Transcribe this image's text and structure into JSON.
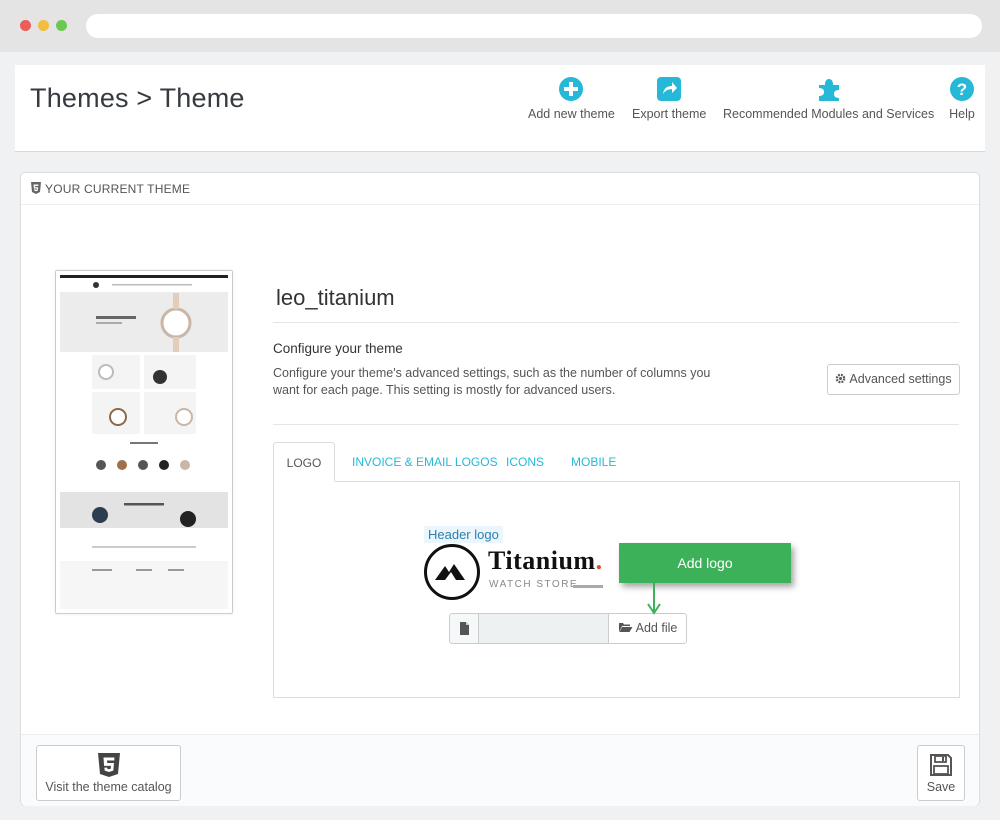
{
  "header": {
    "title": "Themes > Theme",
    "toolbar": [
      {
        "label": "Add new theme",
        "icon": "plus-circle-icon"
      },
      {
        "label": "Export theme",
        "icon": "export-icon"
      },
      {
        "label": "Recommended Modules and Services",
        "icon": "puzzle-icon"
      },
      {
        "label": "Help",
        "icon": "help-icon"
      }
    ]
  },
  "panel": {
    "heading": "YOUR CURRENT THEME",
    "theme_name": "leo_titanium",
    "configure_title": "Configure your theme",
    "configure_desc": "Configure your theme's advanced settings, such as the number of columns you want for each page. This setting is mostly for advanced users.",
    "advanced_settings_label": "Advanced settings"
  },
  "tabs": [
    {
      "label": "LOGO",
      "active": true
    },
    {
      "label": "INVOICE & EMAIL LOGOS",
      "active": false
    },
    {
      "label": "ICONS",
      "active": false
    },
    {
      "label": "MOBILE",
      "active": false
    }
  ],
  "logo_tab": {
    "header_logo_label": "Header logo",
    "logo_word": "Titanium",
    "logo_dot": ".",
    "logo_sub": "WATCH STORE",
    "file_value": "",
    "add_file_label": "Add file",
    "callout": "Add logo"
  },
  "footer": {
    "catalog_label": "Visit the theme catalog",
    "save_label": "Save"
  },
  "colors": {
    "accent": "#25b9d7",
    "callout": "#3cb15a",
    "logo_dot": "#e04b3a"
  }
}
